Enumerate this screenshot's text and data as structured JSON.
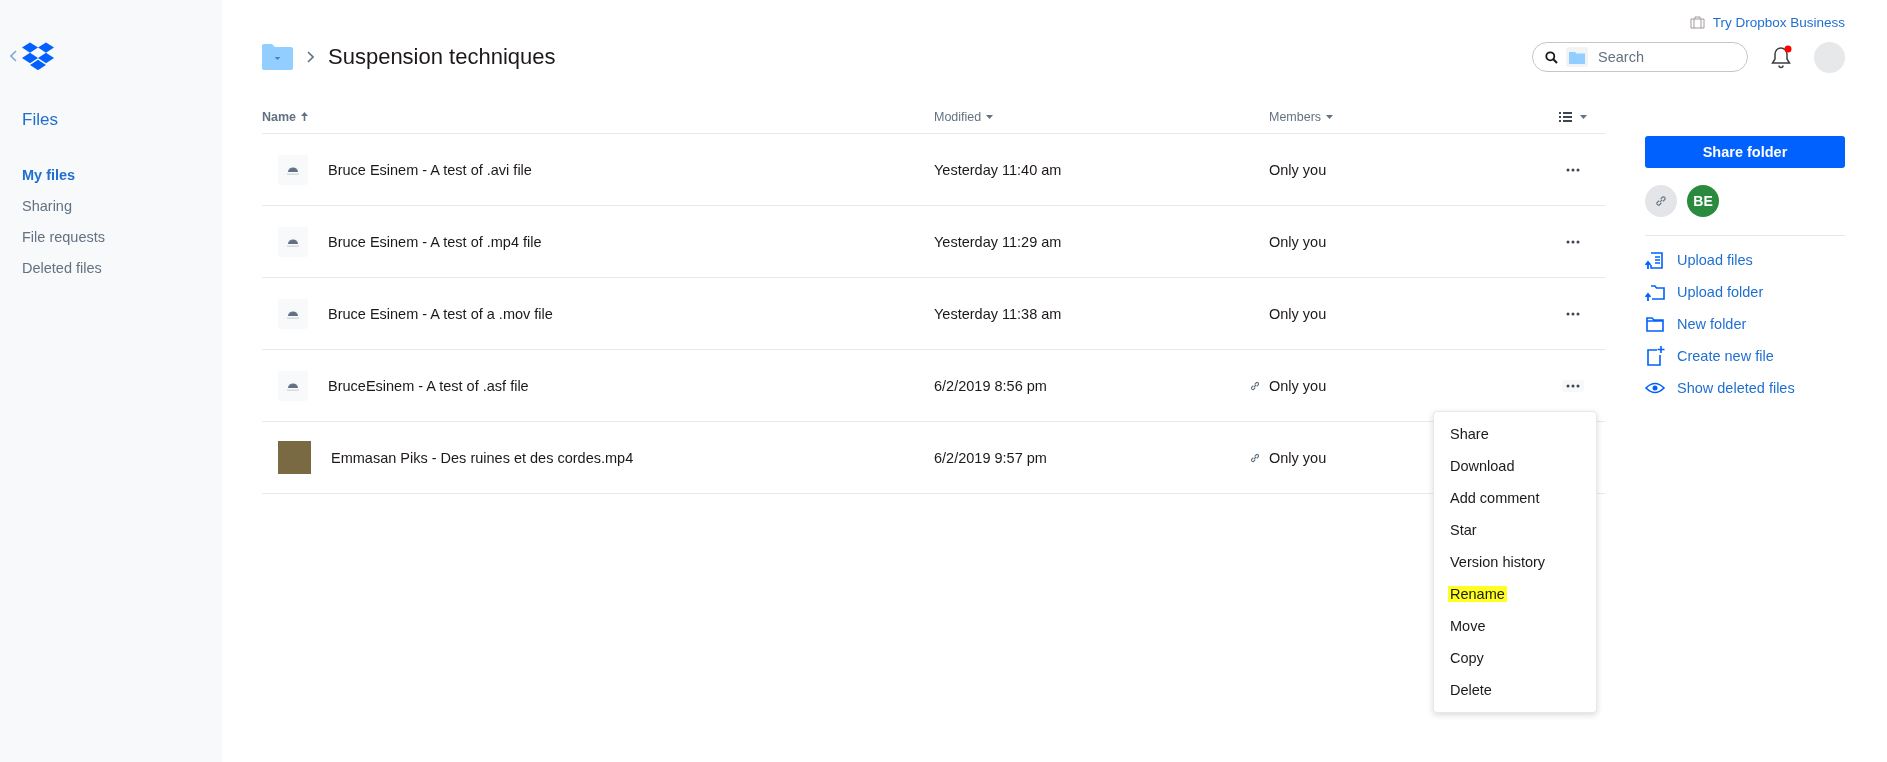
{
  "sidebar": {
    "title": "Files",
    "items": [
      {
        "label": "My files",
        "selected": true
      },
      {
        "label": "Sharing",
        "selected": false
      },
      {
        "label": "File requests",
        "selected": false
      },
      {
        "label": "Deleted files",
        "selected": false
      }
    ]
  },
  "top_link": "Try Dropbox Business",
  "breadcrumb": {
    "title": "Suspension techniques"
  },
  "search": {
    "placeholder": "Search"
  },
  "notifications": {
    "unread": true
  },
  "table": {
    "columns": [
      {
        "label": "Name",
        "sorted": true
      },
      {
        "label": "Modified",
        "sorted": false
      },
      {
        "label": "Members",
        "sorted": false
      }
    ],
    "rows": [
      {
        "kind": "video",
        "name": "Bruce Esinem - A test of .avi file",
        "modified": "Yesterday 11:40 am",
        "members": "Only you",
        "shared_link": false,
        "menu_open": false
      },
      {
        "kind": "video",
        "name": "Bruce Esinem - A test of .mp4 file",
        "modified": "Yesterday 11:29 am",
        "members": "Only you",
        "shared_link": false,
        "menu_open": false
      },
      {
        "kind": "video",
        "name": "Bruce Esinem - A test of a .mov file",
        "modified": "Yesterday 11:38 am",
        "members": "Only you",
        "shared_link": false,
        "menu_open": false
      },
      {
        "kind": "video",
        "name": "BruceEsinem - A test of .asf file",
        "modified": "6/2/2019 8:56 pm",
        "members": "Only you",
        "shared_link": true,
        "menu_open": true
      },
      {
        "kind": "thumbnail",
        "name": "Emmasan Piks - Des ruines et des cordes.mp4",
        "modified": "6/2/2019 9:57 pm",
        "members": "Only you",
        "shared_link": true,
        "menu_open": false
      }
    ]
  },
  "context_menu": {
    "items": [
      {
        "label": "Share",
        "highlighted": false
      },
      {
        "label": "Download",
        "highlighted": false
      },
      {
        "label": "Add comment",
        "highlighted": false
      },
      {
        "label": "Star",
        "highlighted": false
      },
      {
        "label": "Version history",
        "highlighted": false
      },
      {
        "label": "Rename",
        "highlighted": true
      },
      {
        "label": "Move",
        "highlighted": false
      },
      {
        "label": "Copy",
        "highlighted": false
      },
      {
        "label": "Delete",
        "highlighted": false
      }
    ]
  },
  "right_panel": {
    "share_button": "Share folder",
    "member_initials": "BE",
    "actions": [
      {
        "kind": "upload_files",
        "label": "Upload files"
      },
      {
        "kind": "upload_folder",
        "label": "Upload folder"
      },
      {
        "kind": "new_folder",
        "label": "New folder"
      },
      {
        "kind": "new_file",
        "label": "Create new file"
      },
      {
        "kind": "show_deleted",
        "label": "Show deleted files"
      }
    ]
  }
}
